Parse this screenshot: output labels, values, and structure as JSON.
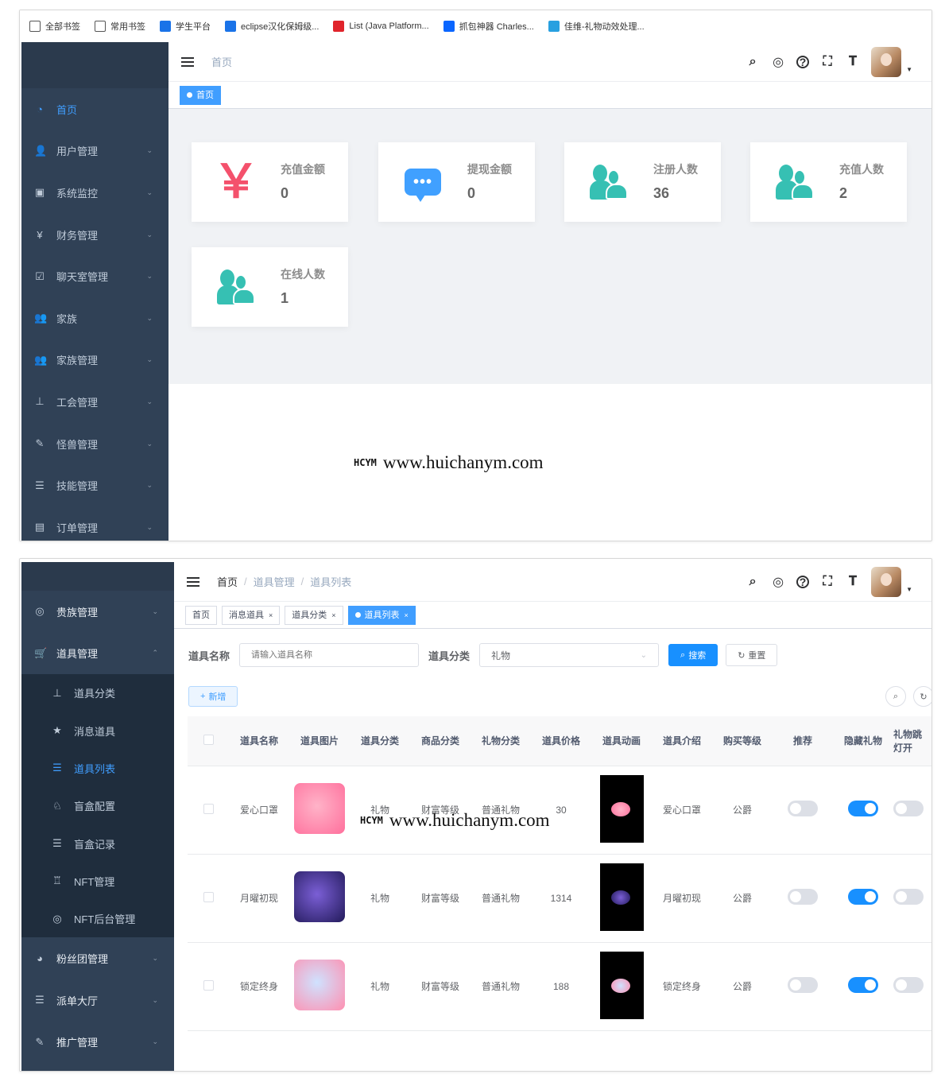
{
  "bookmarks": [
    {
      "label": "全部书签",
      "icon": "star-icon",
      "color": "#555555"
    },
    {
      "label": "常用书签",
      "icon": "bookmark-icon",
      "color": "#555555"
    },
    {
      "label": "学生平台",
      "icon": "square-icon",
      "color": "#1a73e8"
    },
    {
      "label": "eclipse汉化保姆级...",
      "icon": "tv-icon",
      "color": "#1a73e8"
    },
    {
      "label": "List (Java Platform...",
      "icon": "oracle-icon",
      "color": "#e0242b"
    },
    {
      "label": "抓包神器 Charles...",
      "icon": "zhihu-icon",
      "color": "#0a66ff"
    },
    {
      "label": "佳维-礼物动效处理...",
      "icon": "vue-icon",
      "color": "#28a0e0"
    }
  ],
  "screen1": {
    "sidebar": [
      {
        "label": "首页",
        "icon": "dashboard-icon",
        "glyph": "◔",
        "active": true
      },
      {
        "label": "用户管理",
        "icon": "user-icon",
        "glyph": "👤"
      },
      {
        "label": "系统监控",
        "icon": "monitor-icon",
        "glyph": "▣"
      },
      {
        "label": "财务管理",
        "icon": "yen-icon",
        "glyph": "¥"
      },
      {
        "label": "聊天室管理",
        "icon": "checkbox-icon",
        "glyph": "☑"
      },
      {
        "label": "家族",
        "icon": "peoples-icon",
        "glyph": "👥"
      },
      {
        "label": "家族管理",
        "icon": "peoples-icon",
        "glyph": "👥"
      },
      {
        "label": "工会管理",
        "icon": "tree-icon",
        "glyph": "⊥"
      },
      {
        "label": "怪兽管理",
        "icon": "edit-icon",
        "glyph": "✎"
      },
      {
        "label": "技能管理",
        "icon": "list-icon",
        "glyph": "☰"
      },
      {
        "label": "订单管理",
        "icon": "table-icon",
        "glyph": "▤"
      }
    ],
    "breadcrumb": [
      "首页"
    ],
    "tags": [
      {
        "label": "首页",
        "active": true
      }
    ],
    "cards": [
      {
        "label": "充值金额",
        "value": "0",
        "icon": "yen-icon",
        "color": "#f4516c"
      },
      {
        "label": "提现金额",
        "value": "0",
        "icon": "message-icon",
        "color": "#40a0ff"
      },
      {
        "label": "注册人数",
        "value": "36",
        "icon": "peoples-icon",
        "color": "#36c0b3"
      },
      {
        "label": "充值人数",
        "value": "2",
        "icon": "peoples-icon",
        "color": "#36c0b3"
      },
      {
        "label": "在线人数",
        "value": "1",
        "icon": "peoples-icon",
        "color": "#36c0b3"
      }
    ],
    "watermark": {
      "logo": "HCYM",
      "url": "www.huichanym.com"
    }
  },
  "screen2": {
    "sidebar": {
      "top": [
        {
          "label": "贵族管理",
          "icon": "github-icon",
          "glyph": "◎"
        },
        {
          "label": "道具管理",
          "icon": "shopping-icon",
          "glyph": "🛒",
          "expanded": true
        }
      ],
      "sub": [
        {
          "label": "道具分类",
          "icon": "tree-icon",
          "glyph": "⊥"
        },
        {
          "label": "消息道具",
          "icon": "star-icon",
          "glyph": "★"
        },
        {
          "label": "道具列表",
          "icon": "list-icon",
          "glyph": "☰",
          "active": true
        },
        {
          "label": "盲盒配置",
          "icon": "skill-icon",
          "glyph": "♘"
        },
        {
          "label": "盲盒记录",
          "icon": "list-icon",
          "glyph": "☰"
        },
        {
          "label": "NFT管理",
          "icon": "nft-icon",
          "glyph": "♖"
        },
        {
          "label": "NFT后台管理",
          "icon": "color-icon",
          "glyph": "◎"
        }
      ],
      "bottom": [
        {
          "label": "粉丝团管理",
          "icon": "chrome-icon",
          "glyph": "◕"
        },
        {
          "label": "派单大厅",
          "icon": "list-icon",
          "glyph": "☰"
        },
        {
          "label": "推广管理",
          "icon": "edit-icon",
          "glyph": "✎"
        }
      ]
    },
    "breadcrumb": [
      "首页",
      "道具管理",
      "道具列表"
    ],
    "tags": [
      {
        "label": "首页",
        "active": false,
        "closable": false
      },
      {
        "label": "消息道具",
        "active": false,
        "closable": true
      },
      {
        "label": "道具分类",
        "active": false,
        "closable": true
      },
      {
        "label": "道具列表",
        "active": true,
        "closable": true
      }
    ],
    "search": {
      "name_label": "道具名称",
      "name_placeholder": "请输入道具名称",
      "category_label": "道具分类",
      "category_value": "礼物",
      "search_btn": "搜索",
      "reset_btn": "重置",
      "add_btn": "新增"
    },
    "columns": [
      "道具名称",
      "道具图片",
      "道具分类",
      "商品分类",
      "礼物分类",
      "道具价格",
      "道具动画",
      "道具介绍",
      "购买等级",
      "推荐",
      "隐藏礼物",
      "礼物跳\n灯开"
    ],
    "rows": [
      {
        "name": "爱心口罩",
        "category": "礼物",
        "goods": "财富等级",
        "gift": "普通礼物",
        "price": "30",
        "intro": "爱心口罩",
        "level": "公爵",
        "recommend": false,
        "hidden": true,
        "thumb_a": "#ffb3c8",
        "thumb_b": "#ff6f9c"
      },
      {
        "name": "月曜初现",
        "category": "礼物",
        "goods": "财富等级",
        "gift": "普通礼物",
        "price": "1314",
        "intro": "月曜初现",
        "level": "公爵",
        "recommend": false,
        "hidden": true,
        "thumb_a": "#7b5fd6",
        "thumb_b": "#221a5a"
      },
      {
        "name": "锁定终身",
        "category": "礼物",
        "goods": "财富等级",
        "gift": "普通礼物",
        "price": "188",
        "intro": "锁定终身",
        "level": "公爵",
        "recommend": false,
        "hidden": true,
        "thumb_a": "#cfe2ff",
        "thumb_b": "#ff8fb0"
      }
    ],
    "watermark": {
      "logo": "HCYM",
      "url": "www.huichanym.com"
    }
  }
}
